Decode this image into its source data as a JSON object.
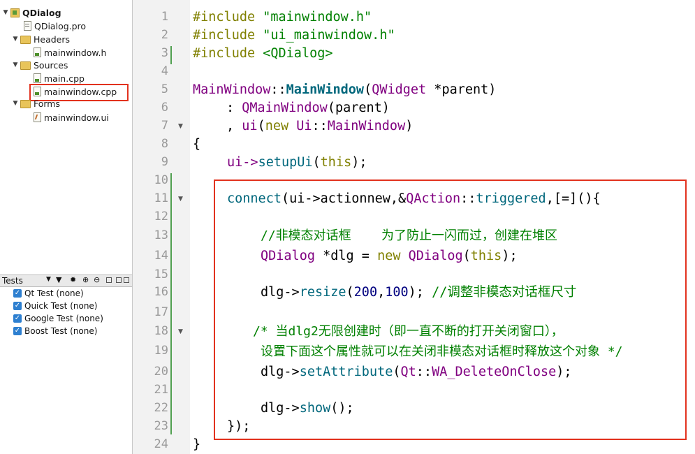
{
  "project_tree": {
    "project": "QDialog",
    "pro_file": "QDialog.pro",
    "headers_label": "Headers",
    "header_file": "mainwindow.h",
    "sources_label": "Sources",
    "source_main": "main.cpp",
    "source_mainwindow": "mainwindow.cpp",
    "forms_label": "Forms",
    "form_file": "mainwindow.ui"
  },
  "tests_panel": {
    "title": "Tests",
    "items": [
      {
        "label": "Qt Test (none)",
        "checked": true
      },
      {
        "label": "Quick Test (none)",
        "checked": true
      },
      {
        "label": "Google Test (none)",
        "checked": true
      },
      {
        "label": "Boost Test (none)",
        "checked": true
      }
    ]
  },
  "editor": {
    "colors": {
      "keyword": "#808000",
      "string": "#008000",
      "function": "#00677c",
      "class": "#800080",
      "comment": "#008000",
      "highlight_border": "#e2321e"
    },
    "line_numbers": [
      "1",
      "2",
      "3",
      "4",
      "5",
      "6",
      "7",
      "8",
      "9",
      "10",
      "11",
      "12",
      "13",
      "14",
      "15",
      "16",
      "17",
      "18",
      "19",
      "20",
      "21",
      "22",
      "23",
      "24"
    ],
    "code": {
      "inc": "#include",
      "h1": "\"mainwindow.h\"",
      "h2": "\"ui_mainwindow.h\"",
      "h3": "<QDialog>",
      "mw_class": "MainWindow",
      "scope": "::",
      "mw_ctor": "MainWindow",
      "paren_open": "(",
      "qwidget": "QWidget",
      "param": " *parent)",
      "colon": ": ",
      "qmainwindow": "QMainWindow",
      "parent_arg": "(parent)",
      "comma": ", ",
      "ui_member": "ui",
      "new_kw": "new",
      "ui_ns": "Ui",
      "mw_tail": "MainWindow",
      "close": ")",
      "brace_open": "{",
      "ui_arrow": "ui->",
      "setup_fn": "setupUi",
      "this_kw": "this",
      "close_semi": ");",
      "connect_fn": "connect",
      "ui_action": "(ui->actionnew,&",
      "qaction": "QAction",
      "triggered_fn": "triggered",
      "lambda": ",[=](){",
      "comment1": "//非模态对话框    为了防止一闪而过，创建在堆区",
      "qdialog1": "QDialog",
      "dlg_assign": " *dlg = ",
      "qdialog2": "QDialog",
      "this_kw2": "this",
      "dlg_arrow": "dlg->",
      "resize_fn": "resize",
      "n200": "200",
      "n100": "100",
      "comment2": "//调整非模态对话框尺寸",
      "comment3": "/* 当dlg2无限创建时（即一直不断的打开关闭窗口），",
      "comment4": "设置下面这个属性就可以在关闭非模态对话框时释放这个对象 */",
      "setattr_fn": "setAttribute",
      "qt_ns": "Qt",
      "wa_enum": "WA_DeleteOnClose",
      "show_fn": "show",
      "lambda_close": "});",
      "brace_close": "}"
    }
  }
}
